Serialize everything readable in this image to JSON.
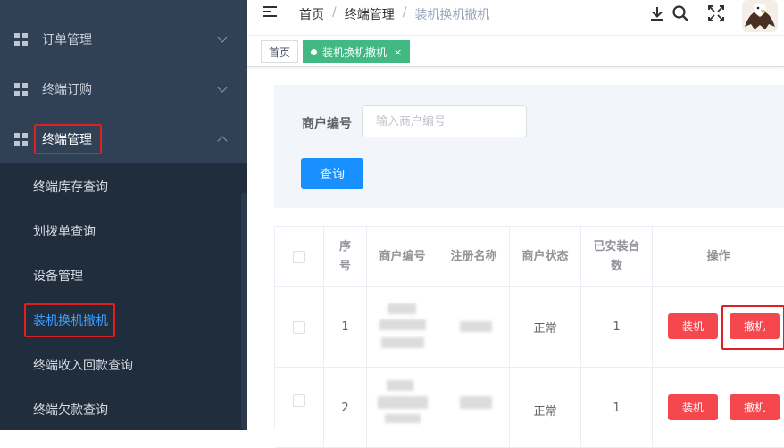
{
  "sidebar": {
    "groups": [
      {
        "label": "订单管理",
        "icon": "grid-icon",
        "expanded": false
      },
      {
        "label": "终端订购",
        "icon": "grid-icon",
        "expanded": false
      },
      {
        "label": "终端管理",
        "icon": "grid-icon",
        "expanded": true
      }
    ],
    "sub_items": [
      {
        "label": "终端库存查询"
      },
      {
        "label": "划拨单查询"
      },
      {
        "label": "设备管理"
      },
      {
        "label": "装机换机撤机",
        "active": true
      },
      {
        "label": "终端收入回款查询"
      },
      {
        "label": "终端欠款查询"
      }
    ]
  },
  "header": {
    "breadcrumb": [
      "首页",
      "终端管理",
      "装机换机撤机"
    ],
    "separator": "/",
    "icons": [
      "download-icon",
      "search-icon",
      "fullscreen-icon"
    ]
  },
  "tags": {
    "home": "首页",
    "current": "装机换机撤机",
    "close": "×"
  },
  "search": {
    "label": "商户编号",
    "placeholder": "输入商户编号",
    "value": "",
    "button": "查询"
  },
  "table": {
    "headers": [
      "",
      "序号",
      "商户编号",
      "注册名称",
      "商户状态",
      "已安装台数",
      "操作"
    ],
    "rows": [
      {
        "index": "1",
        "status": "正常",
        "installed": "1",
        "actions": [
          "装机",
          "撤机"
        ]
      },
      {
        "index": "2",
        "status": "正常",
        "installed": "1",
        "actions": [
          "装机",
          "撤机"
        ]
      }
    ]
  },
  "colors": {
    "sidebar_bg": "#304156",
    "submenu_bg": "#1f2d3d",
    "active_link": "#409eff",
    "tag_active": "#42b983",
    "primary_button": "#1890ff",
    "danger_button": "#f5484e",
    "highlight_box": "#e02020"
  }
}
